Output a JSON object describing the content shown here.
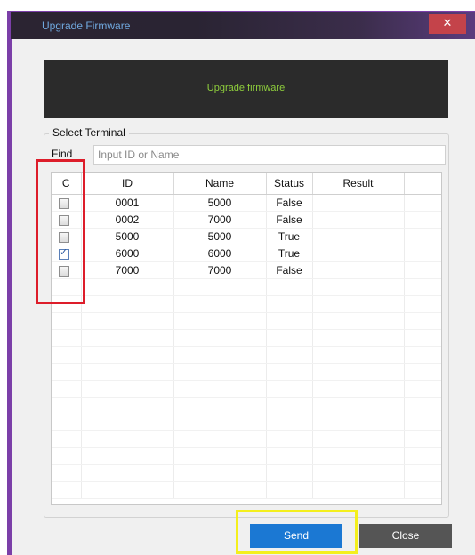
{
  "window": {
    "title": "Upgrade Firmware",
    "close_symbol": "✕"
  },
  "banner": {
    "text": "Upgrade firmware"
  },
  "select_terminal": {
    "group_label": "Select Terminal",
    "find_label": "Find",
    "find_placeholder": "Input ID or Name",
    "find_value": ""
  },
  "table": {
    "columns": [
      "C",
      "ID",
      "Name",
      "Status",
      "Result"
    ],
    "rows": [
      {
        "checked": false,
        "id": "0001",
        "name": "5000",
        "status": "False",
        "result": ""
      },
      {
        "checked": false,
        "id": "0002",
        "name": "7000",
        "status": "False",
        "result": ""
      },
      {
        "checked": false,
        "id": "5000",
        "name": "5000",
        "status": "True",
        "result": ""
      },
      {
        "checked": true,
        "id": "6000",
        "name": "6000",
        "status": "True",
        "result": ""
      },
      {
        "checked": false,
        "id": "7000",
        "name": "7000",
        "status": "False",
        "result": ""
      }
    ]
  },
  "buttons": {
    "send": "Send",
    "close": "Close"
  },
  "colors": {
    "accent_send": "#1b78d3",
    "close_button": "#555555",
    "highlight_red": "#dd1d2a",
    "highlight_yellow": "#f4ef1d",
    "banner_text": "#8fcf3c",
    "window_frame": "#7b3fa8"
  }
}
